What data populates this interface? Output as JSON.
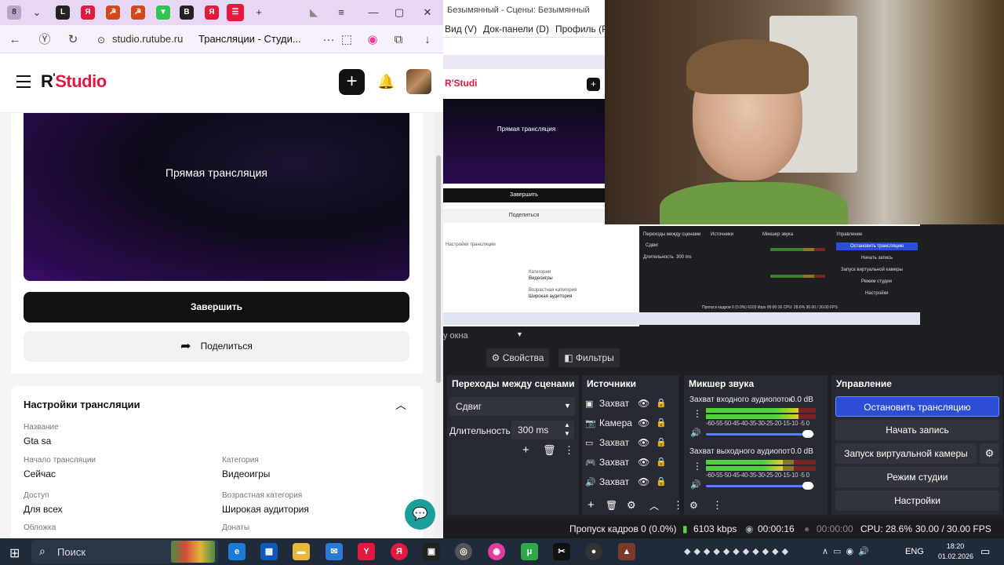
{
  "browser": {
    "tab_title_counter": "8",
    "url_domain": "studio.rutube.ru",
    "tab_title": "Трансляции - Студи...",
    "ellipsis": "···"
  },
  "site": {
    "logo_r": "R",
    "logo_text": "Studio",
    "preview_title": "Прямая трансляция",
    "finish_label": "Завершить",
    "share_label": "Поделиться",
    "settings_title": "Настройки трансляции",
    "fields": {
      "name_label": "Название",
      "name_value": "Gta sa",
      "start_label": "Начало трансляции",
      "start_value": "Сейчас",
      "category_label": "Категория",
      "category_value": "Видеоигры",
      "access_label": "Доступ",
      "access_value": "Для всех",
      "age_label": "Возрастная категория",
      "age_value": "Широкая аудитория",
      "cover_label": "Обложка",
      "donates_label": "Донаты"
    }
  },
  "obs": {
    "window_title": "Безымянный - Сцены: Безымянный",
    "menu": [
      "Вид (V)",
      "Док-панели (D)",
      "Профиль (P)"
    ],
    "nested": {
      "logo": "R'Studi",
      "preview_title": "Прямая трансляция",
      "finish": "Завершить",
      "share": "Поделиться",
      "settings": "Настройки трансляции",
      "category_label": "Категория",
      "category_value": "Видеоигры",
      "age_label": "Возрастная категория",
      "age_value": "Широкая аудитория",
      "mini_transitions": "Переходы между сценами",
      "mini_sources": "Источники",
      "mini_mixer": "Микшер звука",
      "mini_controls": "Управление",
      "mini_stop": "Остановить трансляцию",
      "mini_record": "Начать запись",
      "mini_virtual": "Запуск виртуальной камеры",
      "mini_studio": "Режим студии",
      "mini_settings": "Настройки",
      "mini_shift": "Сдвиг",
      "mini_duration": "Длительность",
      "mini_ms": "300 ms",
      "mini_status": "Пропуск кадров 0 (0.0%)   6103 kbps   00:00:16   CPU: 28.6%   30.00 / 30.00 FPS"
    },
    "dock_title": "у окна",
    "properties_label": "Свойства",
    "filters_label": "Фильтры",
    "transitions": {
      "header": "Переходы между сценами",
      "combo_value": "Сдвиг",
      "duration_label": "Длительность",
      "duration_value": "300 ms"
    },
    "sources": {
      "header": "Источники",
      "items": [
        {
          "label": "Захват",
          "icon": "window-icon"
        },
        {
          "label": "Камера",
          "icon": "camera-icon"
        },
        {
          "label": "Захват",
          "icon": "monitor-icon"
        },
        {
          "label": "Захват",
          "icon": "gamepad-icon"
        },
        {
          "label": "Захват",
          "icon": "speaker-icon"
        }
      ]
    },
    "mixer": {
      "header": "Микшер звука",
      "channels": [
        {
          "name": "Захват входного аудиопоток",
          "db": "0.0 dB",
          "level": 0.84
        },
        {
          "name": "Захват выходного аудиопот",
          "db": "0.0 dB",
          "level": 0.7
        }
      ],
      "scale": "-60-55-50-45-40-35-30-25-20-15-10 -5 0"
    },
    "controls": {
      "header": "Управление",
      "stop": "Остановить трансляцию",
      "record": "Начать запись",
      "virtual_cam": "Запуск виртуальной камеры",
      "studio_mode": "Режим студии",
      "settings": "Настройки"
    },
    "status": {
      "dropped": "Пропуск кадров 0 (0.0%)",
      "bitrate": "6103 kbps",
      "stream_time": "00:00:16",
      "rec_time": "00:00:00",
      "cpu": "CPU: 28.6%",
      "fps": "30.00 / 30.00 FPS"
    },
    "colors": {
      "accent": "#2c4dd6",
      "panel": "#272a33",
      "bg": "#1e1f23"
    }
  },
  "taskbar": {
    "search_label": "Поиск",
    "lang": "ENG",
    "time": "18:20",
    "date": "01.02.2026"
  }
}
